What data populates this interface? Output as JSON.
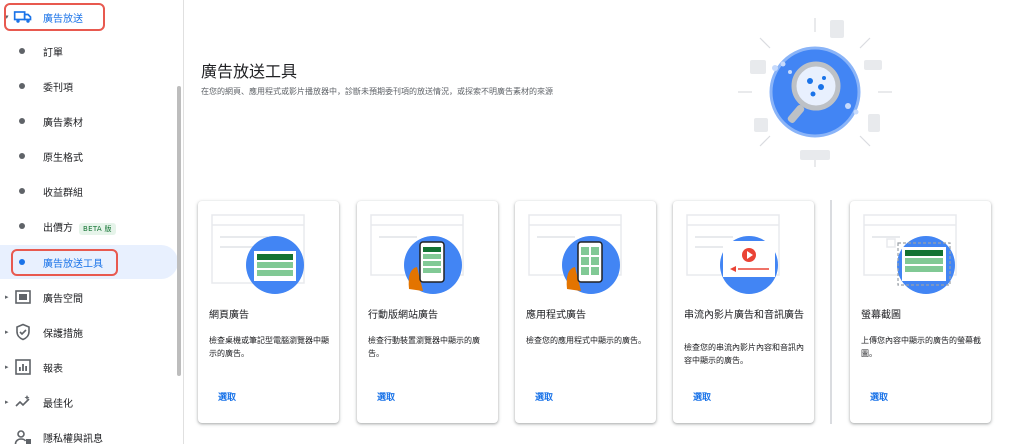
{
  "sidebar": {
    "top_item": {
      "label": "廣告放送"
    },
    "items": [
      {
        "label": "訂單"
      },
      {
        "label": "委刊項"
      },
      {
        "label": "廣告素材"
      },
      {
        "label": "原生格式"
      },
      {
        "label": "收益群組"
      },
      {
        "label": "出價方",
        "badge": "BETA 版"
      },
      {
        "label": "廣告放送工具"
      }
    ],
    "sections": [
      {
        "label": "廣告空間",
        "icon": "ad-space-icon"
      },
      {
        "label": "保護措施",
        "icon": "shield-icon"
      },
      {
        "label": "報表",
        "icon": "report-icon"
      },
      {
        "label": "最佳化",
        "icon": "optimization-icon"
      },
      {
        "label": "隱私權與訊息",
        "icon": "privacy-icon"
      }
    ]
  },
  "main": {
    "title": "廣告放送工具",
    "subtitle": "在您的網頁、應用程式或影片播放器中，診斷未預期委刊項的放送情況，或探索不明廣告素材的來源"
  },
  "cards": [
    {
      "title": "網頁廣告",
      "desc": "檢查桌機或筆記型電腦瀏覽器中顯示的廣告。",
      "button": "選取"
    },
    {
      "title": "行動版網站廣告",
      "desc": "檢查行動裝置瀏覽器中顯示的廣告。",
      "button": "選取"
    },
    {
      "title": "應用程式廣告",
      "desc": "檢查您的應用程式中顯示的廣告。",
      "button": "選取"
    },
    {
      "title": "串流內影片廣告和音訊廣告",
      "desc": "檢查您的串流內影片內容和音訊內容中顯示的廣告。",
      "button": "選取"
    },
    {
      "title": "螢幕截圖",
      "desc": "上傳您內容中顯示的廣告的螢幕截圖。",
      "button": "選取"
    }
  ],
  "colors": {
    "accent": "#1a73e8",
    "highlight": "#e8594f",
    "selected_bg": "#e8f0fe",
    "illustration_blue": "#4285f4",
    "illustration_green": "#34a853",
    "illustration_orange": "#e37400"
  }
}
